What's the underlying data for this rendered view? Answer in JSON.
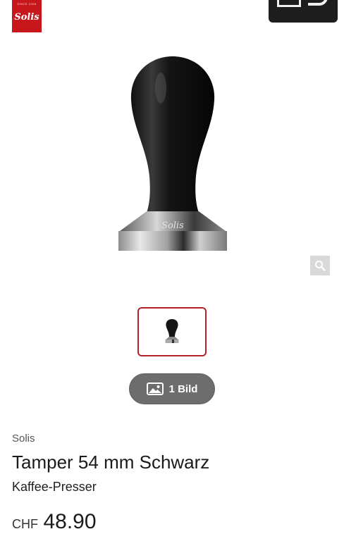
{
  "header": {
    "logo_since": "SINCE 1908",
    "logo_text": "Solis"
  },
  "gallery": {
    "image_engraving": "Solis",
    "thumbnail_count": 1,
    "images_button_label": "1 Bild"
  },
  "product": {
    "brand": "Solis",
    "title": "Tamper 54 mm Schwarz",
    "subtitle": "Kaffee-Presser",
    "currency": "CHF",
    "price": "48.90"
  },
  "colors": {
    "brand_red": "#c8161d",
    "thumbnail_border": "#b3212b",
    "button_bg": "#6d6d6d"
  },
  "icons": {
    "zoom": "magnifier-icon",
    "images": "image-icon"
  }
}
